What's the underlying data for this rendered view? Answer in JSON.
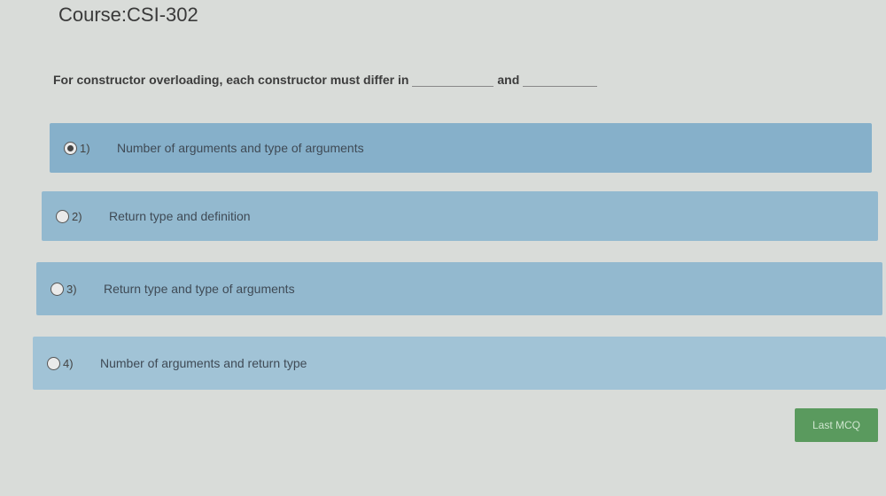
{
  "course": {
    "title": "Course:CSI-302"
  },
  "question": {
    "text_part1": "For constructor overloading, each constructor must differ in",
    "text_part2": "and"
  },
  "options": [
    {
      "number": "1)",
      "label": "Number of arguments and type of arguments",
      "selected": true
    },
    {
      "number": "2)",
      "label": "Return type and definition",
      "selected": false
    },
    {
      "number": "3)",
      "label": "Return type and type of arguments",
      "selected": false
    },
    {
      "number": "4)",
      "label": "Number of arguments and return type",
      "selected": false
    }
  ],
  "navigation": {
    "last_mcq_label": "Last MCQ"
  }
}
